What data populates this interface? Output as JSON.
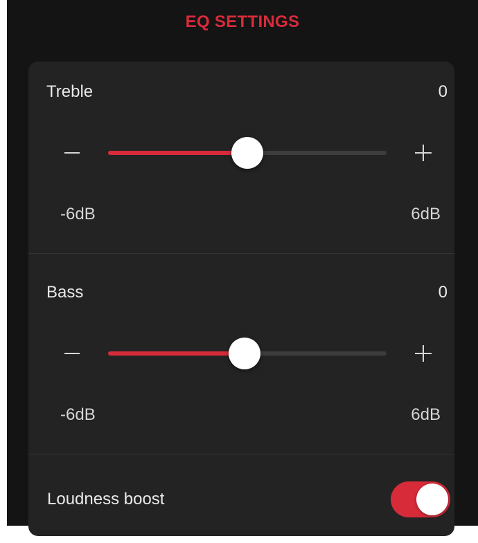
{
  "header": {
    "title": "EQ SETTINGS"
  },
  "treble": {
    "label": "Treble",
    "value": "0",
    "min_label": "-6dB",
    "max_label": "6dB",
    "level": 0.5
  },
  "bass": {
    "label": "Bass",
    "value": "0",
    "min_label": "-6dB",
    "max_label": "6dB",
    "level": 0.49
  },
  "loudness": {
    "label": "Loudness boost",
    "enabled": true
  },
  "colors": {
    "accent": "#d82b3a",
    "background": "#141414",
    "card": "#232323",
    "track": "#3d3d3d"
  },
  "icons": {
    "decrease": "minus-icon",
    "increase": "plus-icon"
  }
}
